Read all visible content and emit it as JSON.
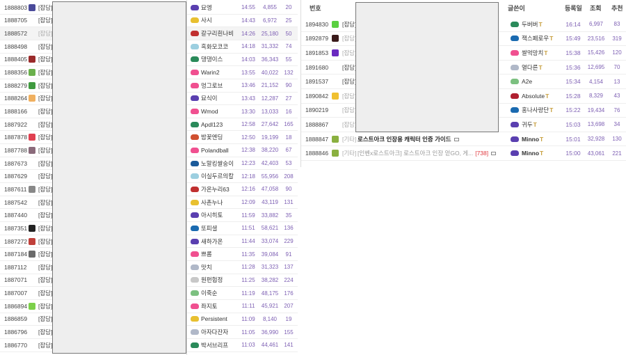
{
  "left_list": [
    {
      "id": "1888803",
      "icon": "#4a4a9a",
      "tag": "[잡담]"
    },
    {
      "id": "1888705",
      "icon": null,
      "tag": "[잡담]"
    },
    {
      "id": "1888572",
      "icon": null,
      "tag": "[잡담]",
      "read": true,
      "highlight": true
    },
    {
      "id": "1888498",
      "icon": null,
      "tag": "[잡담]"
    },
    {
      "id": "1888405",
      "icon": "#9a2a2a",
      "tag": "[잡담]"
    },
    {
      "id": "1888356",
      "icon": "#6ab04c",
      "tag": "[잡담]"
    },
    {
      "id": "1888279",
      "icon": "#3f9a3f",
      "tag": "[잡담]"
    },
    {
      "id": "1888264",
      "icon": "#f0b060",
      "tag": "[잡담]"
    },
    {
      "id": "1888166",
      "icon": null,
      "tag": "[잡담]"
    },
    {
      "id": "1887922",
      "icon": null,
      "tag": "[잡담]"
    },
    {
      "id": "1887878",
      "icon": "#e04050",
      "tag": "[잡담]"
    },
    {
      "id": "1887788",
      "icon": "#8a6a7a",
      "tag": "[잡담]"
    },
    {
      "id": "1887673",
      "icon": null,
      "tag": "[잡담]"
    },
    {
      "id": "1887629",
      "icon": null,
      "tag": "[잡담]"
    },
    {
      "id": "1887611",
      "icon": "#888888",
      "tag": "[잡담]"
    },
    {
      "id": "1887542",
      "icon": null,
      "tag": "[잡담]"
    },
    {
      "id": "1887440",
      "icon": null,
      "tag": "[잡담]"
    },
    {
      "id": "1887351",
      "icon": "#222222",
      "tag": "[잡담]"
    },
    {
      "id": "1887272",
      "icon": "#c0403a",
      "tag": "[잡담]"
    },
    {
      "id": "1887184",
      "icon": "#6a6a6a",
      "tag": "[잡담]"
    },
    {
      "id": "1887112",
      "icon": null,
      "tag": "[잡담]"
    },
    {
      "id": "1887071",
      "icon": null,
      "tag": "[잡담]"
    },
    {
      "id": "1887007",
      "icon": null,
      "tag": "[잡담]"
    },
    {
      "id": "1886894",
      "icon": "#7cd04a",
      "tag": "[잡담]"
    },
    {
      "id": "1886859",
      "icon": null,
      "tag": "[잡담]"
    },
    {
      "id": "1886796",
      "icon": null,
      "tag": "[잡담]"
    },
    {
      "id": "1886770",
      "icon": null,
      "tag": "[잡담]"
    }
  ],
  "mid_list": [
    {
      "name": "묘엥",
      "badge": "#5a3fb0",
      "time": "14:55",
      "views": "4,855",
      "likes": "20"
    },
    {
      "name": "사시",
      "badge": "#e8c030",
      "time": "14:43",
      "views": "6,972",
      "likes": "25"
    },
    {
      "name": "갈구리흰나비",
      "badge": "#c03030",
      "time": "14:26",
      "views": "25,180",
      "likes": "50",
      "highlight": true
    },
    {
      "name": "흑화모코코",
      "badge": "#9ccfe0",
      "time": "14:18",
      "views": "31,332",
      "likes": "74"
    },
    {
      "name": "댕댕이스",
      "badge": "#2a8a5a",
      "time": "14:03",
      "views": "36,343",
      "likes": "55"
    },
    {
      "name": "Warin2",
      "badge": "#f05090",
      "time": "13:55",
      "views": "40,022",
      "likes": "132"
    },
    {
      "name": "멍그로브",
      "badge": "#f05090",
      "time": "13:46",
      "views": "21,152",
      "likes": "90"
    },
    {
      "name": "묘식이",
      "badge": "#5a3fb0",
      "time": "13:43",
      "views": "12,287",
      "likes": "27"
    },
    {
      "name": "Wmod",
      "badge": "#f05090",
      "time": "13:30",
      "views": "13,033",
      "likes": "16"
    },
    {
      "name": "Apdl123",
      "badge": "#2a8a5a",
      "time": "12:58",
      "views": "27,642",
      "likes": "165"
    },
    {
      "name": "밤꽃엔딩",
      "badge": "#d05030",
      "time": "12:50",
      "views": "19,199",
      "likes": "18"
    },
    {
      "name": "Polandball",
      "badge": "#f05090",
      "time": "12:38",
      "views": "38,220",
      "likes": "67"
    },
    {
      "name": "노말킹쌀숭이",
      "badge": "#1a5a9a",
      "time": "12:23",
      "views": "42,403",
      "likes": "53"
    },
    {
      "name": "이실두르의칼",
      "badge": "#9ccfe0",
      "time": "12:18",
      "views": "55,956",
      "likes": "208"
    },
    {
      "name": "가온누리63",
      "badge": "#c03030",
      "time": "12:16",
      "views": "47,058",
      "likes": "90"
    },
    {
      "name": "사촌누나",
      "badge": "#e8c030",
      "time": "12:09",
      "views": "43,119",
      "likes": "131"
    },
    {
      "name": "아시히토",
      "badge": "#5a3fb0",
      "time": "11:59",
      "views": "33,882",
      "likes": "35"
    },
    {
      "name": "또피셜",
      "badge": "#1a6ab0",
      "time": "11:51",
      "views": "58,621",
      "likes": "136"
    },
    {
      "name": "새하가온",
      "badge": "#5a3fb0",
      "time": "11:44",
      "views": "33,074",
      "likes": "229"
    },
    {
      "name": "쁘롬",
      "badge": "#f05090",
      "time": "11:35",
      "views": "39,084",
      "likes": "91"
    },
    {
      "name": "맛치",
      "badge": "#b0b8c8",
      "time": "11:28",
      "views": "31,323",
      "likes": "137"
    },
    {
      "name": "원펀헙정",
      "badge": "#c8c8c8",
      "time": "11:25",
      "views": "38,282",
      "likes": "224"
    },
    {
      "name": "이죽순",
      "badge": "#7cc080",
      "time": "11:19",
      "views": "48,175",
      "likes": "176"
    },
    {
      "name": "좌지토",
      "badge": "#f05090",
      "time": "11:11",
      "views": "45,921",
      "likes": "207"
    },
    {
      "name": "Persistent",
      "badge": "#e8c030",
      "time": "11:09",
      "views": "8,140",
      "likes": "19"
    },
    {
      "name": "아자다잔자",
      "badge": "#b0b8c8",
      "time": "11:05",
      "views": "36,990",
      "likes": "155"
    },
    {
      "name": "박서브리프",
      "badge": "#2a8a5a",
      "time": "11:03",
      "views": "44,461",
      "likes": "141"
    }
  ],
  "right_table": {
    "headers": {
      "no": "번호",
      "writer": "글쓴이",
      "date": "등록일",
      "views": "조회",
      "likes": "추천"
    },
    "rows": [
      {
        "id": "1894830",
        "icon": "#5ad040",
        "tag": "[잡담]",
        "writer": "두버버",
        "badge": "#2a8a5a",
        "time": "16:14",
        "views": "6,997",
        "likes": "83",
        "verified": true
      },
      {
        "id": "1892879",
        "icon": "#3a1a1a",
        "tag": "[잡담]",
        "read": true,
        "writer": "잭스페로우",
        "badge": "#1a6ab0",
        "time": "15:49",
        "views": "23,516",
        "likes": "319",
        "verified": true
      },
      {
        "id": "1891853",
        "icon": "#6a2ac0",
        "tag": "[잡담]",
        "read": true,
        "writer": "쌀먹망치",
        "badge": "#f05090",
        "time": "15:38",
        "views": "15,426",
        "likes": "120",
        "verified": true
      },
      {
        "id": "1891680",
        "icon": null,
        "tag": "[잡담]",
        "writer": "열다른",
        "badge": "#b0b8c8",
        "time": "15:36",
        "views": "12,695",
        "likes": "70",
        "verified": true
      },
      {
        "id": "1891537",
        "icon": null,
        "tag": "[잡담]",
        "writer": "A2e",
        "badge": "#7cc080",
        "time": "15:34",
        "views": "4,154",
        "likes": "13"
      },
      {
        "id": "1890842",
        "icon": "#f0c030",
        "tag": "[잡담]",
        "read": true,
        "writer": "Absolute",
        "badge": "#b02030",
        "time": "15:28",
        "views": "8,329",
        "likes": "43",
        "verified": true
      },
      {
        "id": "1890219",
        "icon": null,
        "tag": "[잡담]",
        "read": true,
        "writer": "홍나사랑단",
        "badge": "#1a6ab0",
        "time": "15:22",
        "views": "19,434",
        "likes": "76",
        "verified": true
      },
      {
        "id": "1888867",
        "icon": null,
        "tag": "[잡담]",
        "read": true,
        "writer": "귀두",
        "badge": "#5a3fb0",
        "time": "15:03",
        "views": "13,698",
        "likes": "34",
        "verified": true
      },
      {
        "id": "1888847",
        "icon": "#8ab040",
        "tag": "[기타]",
        "read": true,
        "title": "로스트아크 인장용 캐릭터 인증 가이드",
        "bold": true,
        "writer": "Minno",
        "badge": "#5a3fb0",
        "time": "15:01",
        "views": "32,928",
        "likes": "130",
        "verified": true
      },
      {
        "id": "1888846",
        "icon": "#8ab040",
        "tag": "[기타]",
        "read": true,
        "title": "[인벤x로스트아크] 로스트아크 인장 얻GO, 게...",
        "comments": "[738]",
        "writer": "Minno",
        "badge": "#5a3fb0",
        "time": "15:00",
        "views": "43,061",
        "likes": "221",
        "verified": true
      }
    ]
  },
  "verified_mark": "T"
}
